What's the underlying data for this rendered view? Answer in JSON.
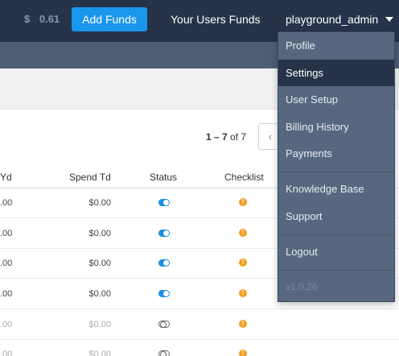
{
  "header": {
    "balance_symbol": "$",
    "balance_value": "0.61",
    "add_funds_label": "Add Funds",
    "users_funds_label": "Your Users Funds",
    "username": "playground_admin"
  },
  "pagination": {
    "range": "1 – 7",
    "of_label": "of 7",
    "prev_icon": "‹"
  },
  "table": {
    "columns": {
      "yd": "Yd",
      "spend_td": "Spend Td",
      "status": "Status",
      "checklist": "Checklist"
    },
    "rows": [
      {
        "yd": ".00",
        "spend_td": "$0.00",
        "status": "on",
        "checklist": "!"
      },
      {
        "yd": ".00",
        "spend_td": "$0.00",
        "status": "on",
        "checklist": "!"
      },
      {
        "yd": ".00",
        "spend_td": "$0.00",
        "status": "on",
        "checklist": "!"
      },
      {
        "yd": ".00",
        "spend_td": "$0.00",
        "status": "on",
        "checklist": "!"
      },
      {
        "yd": ".00",
        "spend_td": "$0.00",
        "status": "off",
        "checklist": "!"
      },
      {
        "yd": ".00",
        "spend_td": "$0.00",
        "status": "off",
        "checklist": "!"
      }
    ]
  },
  "user_menu": {
    "items": [
      {
        "label": "Profile"
      },
      {
        "label": "Settings",
        "active": true
      },
      {
        "label": "User Setup"
      },
      {
        "label": "Billing History"
      },
      {
        "label": "Payments"
      },
      {
        "label": "Knowledge Base"
      },
      {
        "label": "Support"
      },
      {
        "label": "Logout"
      }
    ],
    "version": "v1.0.26"
  },
  "colors": {
    "topbar": "#263349",
    "accent": "#1a96ec",
    "warning": "#f0a020",
    "menu_bg": "#56677f"
  }
}
